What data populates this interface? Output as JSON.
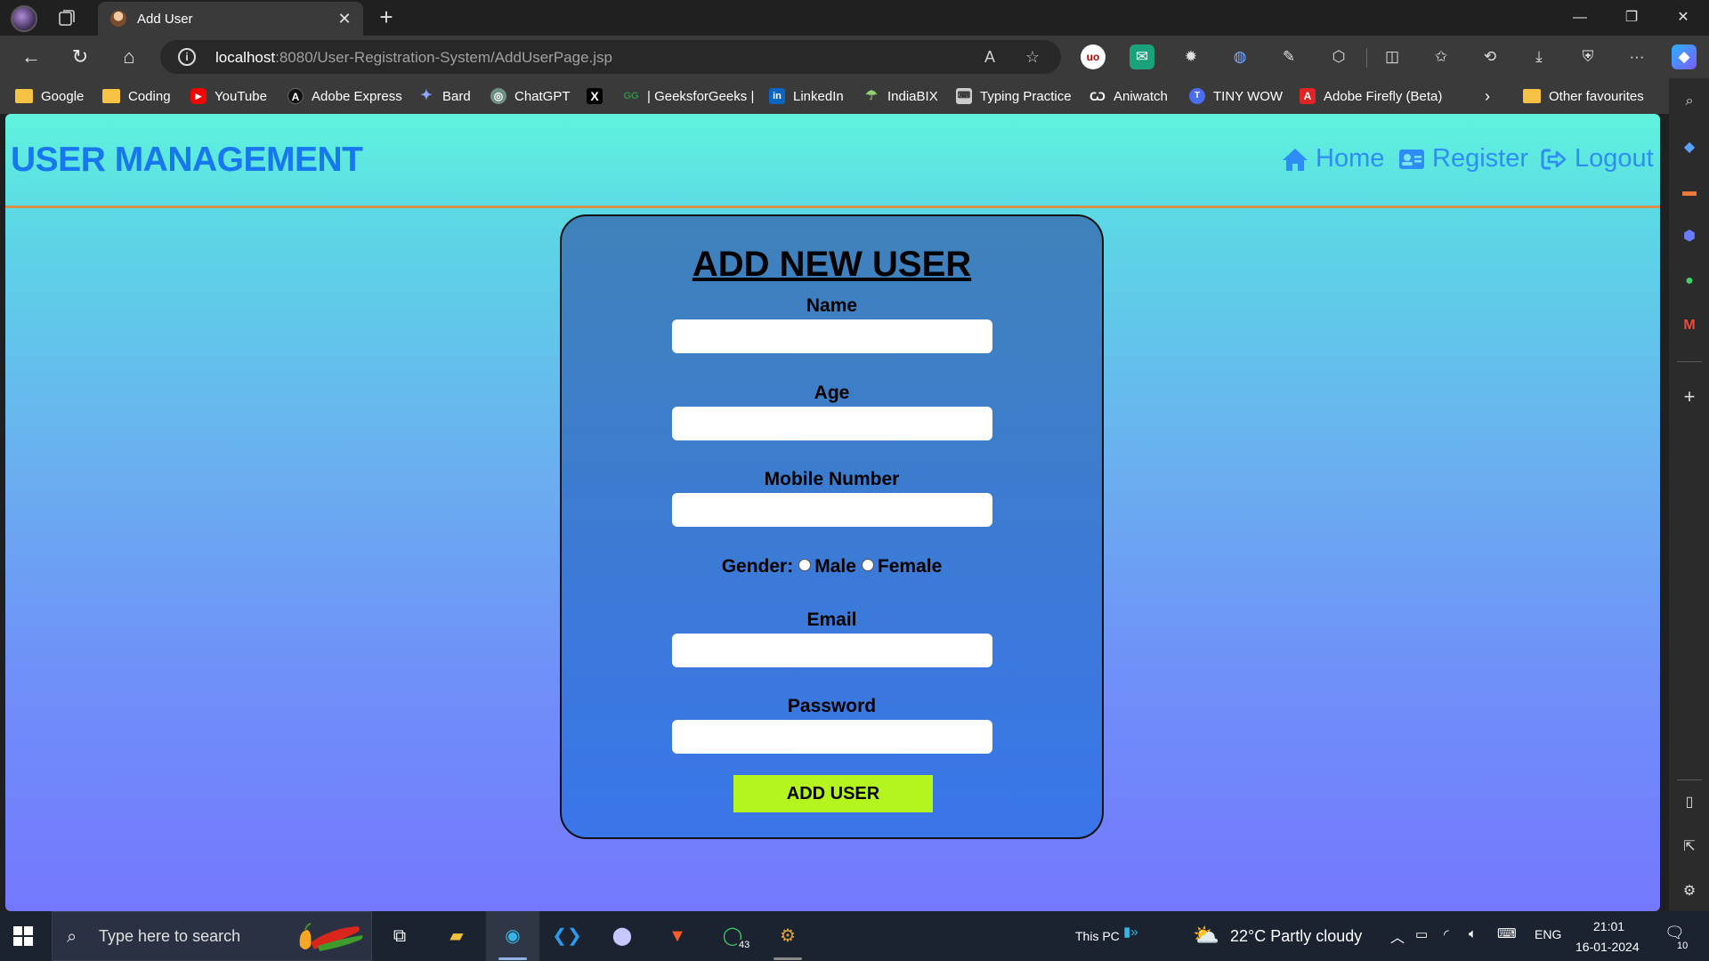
{
  "browser": {
    "tab_title": "Add User",
    "url_host": "localhost",
    "url_rest": ":8080/User-Registration-System/AddUserPage.jsp"
  },
  "favourites": [
    {
      "label": "Google",
      "icon": "folder-icon"
    },
    {
      "label": "Coding",
      "icon": "folder-icon"
    },
    {
      "label": "YouTube",
      "icon": "youtube-icon"
    },
    {
      "label": "Adobe Express",
      "icon": "adobe-express-icon"
    },
    {
      "label": "Bard",
      "icon": "bard-icon"
    },
    {
      "label": "ChatGPT",
      "icon": "chatgpt-icon"
    },
    {
      "label": "",
      "icon": "x-icon"
    },
    {
      "label": "| GeeksforGeeks |",
      "icon": "geeksforgeeks-icon"
    },
    {
      "label": "LinkedIn",
      "icon": "linkedin-icon"
    },
    {
      "label": "IndiaBIX",
      "icon": "indiabix-icon"
    },
    {
      "label": "Typing Practice",
      "icon": "typing-icon"
    },
    {
      "label": "Aniwatch",
      "icon": "aniwatch-icon"
    },
    {
      "label": "TINY WOW",
      "icon": "tinywow-icon"
    },
    {
      "label": "Adobe Firefly (Beta)",
      "icon": "adobe-firefly-icon"
    }
  ],
  "other_favourites": "Other favourites",
  "page": {
    "brand": "USER MANAGEMENT",
    "nav": {
      "home": "Home",
      "register": "Register",
      "logout": "Logout"
    },
    "form": {
      "title": "ADD NEW USER",
      "name_label": "Name",
      "age_label": "Age",
      "mobile_label": "Mobile Number",
      "gender_label": "Gender:",
      "male_label": "Male",
      "female_label": "Female",
      "email_label": "Email",
      "password_label": "Password",
      "name_value": "",
      "age_value": "",
      "mobile_value": "",
      "email_value": "",
      "password_value": "",
      "submit_label": "ADD USER"
    }
  },
  "taskbar": {
    "search_placeholder": "Type here to search",
    "whatsapp_badge": "43",
    "this_pc": "This PC",
    "weather": "22°C  Partly cloudy",
    "language": "ENG",
    "time": "21:01",
    "date": "16-01-2024",
    "notification_count": "10"
  },
  "colors": {
    "brand": "#1777ef",
    "nav_link": "#2e8df4",
    "header_line": "#d7914a",
    "submit_bg": "#b5f51f"
  }
}
